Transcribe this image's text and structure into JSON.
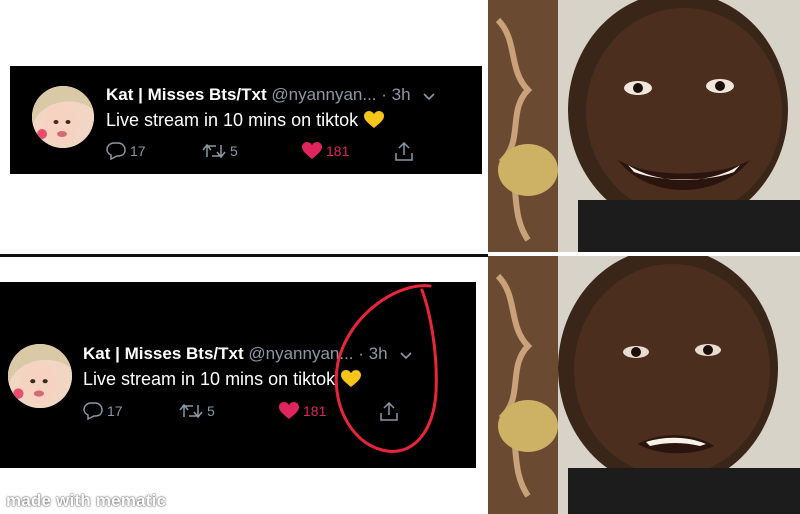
{
  "tweet": {
    "name": "Kat | Misses Bts/Txt",
    "handle": "@nyannyan...",
    "separator": "·",
    "time": "3h",
    "text": "Live stream in 10 mins on tiktok",
    "replies": "17",
    "retweets": "5",
    "likes": "181",
    "like_color": "#e0245e",
    "muted_color": "#8b98a5"
  },
  "annotation": {
    "color": "#e8253a",
    "target": "share-icon"
  },
  "watermark": "made with mematic",
  "icons": [
    "reply-icon",
    "retweet-icon",
    "like-icon",
    "share-icon",
    "chevron-down-icon",
    "yellow-heart-icon"
  ]
}
